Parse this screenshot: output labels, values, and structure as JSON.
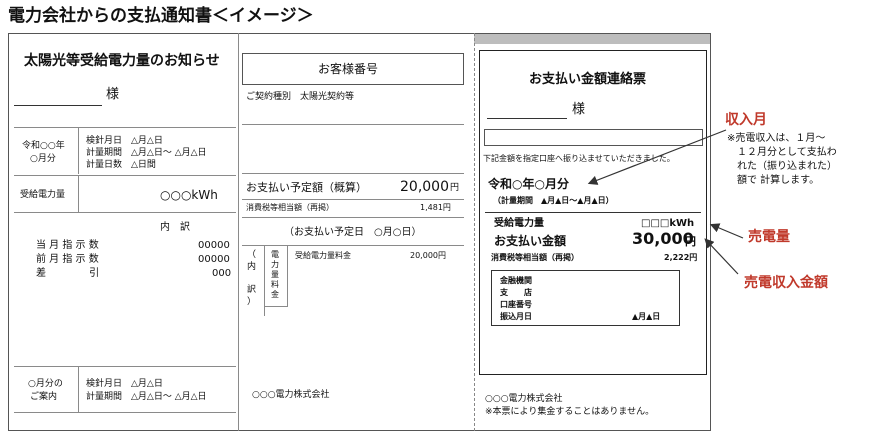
{
  "page_title": "電力会社からの支払通知書＜イメージ＞",
  "left": {
    "heading": "太陽光等受給電力量のお知らせ",
    "sama": "様",
    "period_label_1": "令和○○年",
    "period_label_2": "○月分",
    "meter_lines": [
      "検針月日　△月△日",
      "計量期間　△月△日～ △月△日",
      "計量日数　△日間"
    ],
    "received_label": "受給電力量",
    "received_value": "○○○kWh",
    "breakdown_title": "内　訳",
    "rows": [
      {
        "label": "当 月 指 示 数",
        "value": "00000"
      },
      {
        "label": "前 月 指 示 数",
        "value": "00000"
      },
      {
        "label": "差　　　　 引",
        "value": "000"
      }
    ],
    "next_label_1": "○月分の",
    "next_label_2": "ご案内",
    "next_lines": [
      "検針月日　△月△日",
      "計量期間　△月△日～ △月△日"
    ]
  },
  "middle": {
    "customer_no_label": "お客様番号",
    "contract_type": "ご契約種別　太陽光契約等",
    "payment_label": "お支払い予定額（概算）",
    "payment_value": "20,000",
    "yen": "円",
    "tax_label": "消費税等相当額（再掲）",
    "tax_value": "1,481円",
    "pay_date": "（お支払い予定日　○月○日）",
    "uchiwake_v": "（\n内\n\n訳\n）",
    "fee_header_v": "電\n力\n量\n料\n金",
    "fee_label": "受給電力量料金",
    "fee_value": "20,000円",
    "company": "○○○電力株式会社"
  },
  "right": {
    "heading": "お支払い金額連絡票",
    "sama": "様",
    "transfer_note": "下記金額を指定口座へ振り込ませていただきました。",
    "month": "令和○年○月分",
    "period": "（計量期間　▲月▲日～▲月▲日）",
    "received_label": "受給電力量",
    "received_value": "□□□kWh",
    "amount_label": "お支払い金額",
    "amount_value": "30,000",
    "yen": "円",
    "tax_label": "消費税等相当額（再掲）",
    "tax_value": "2,222円",
    "bank_labels": [
      "金融機関",
      "支　　店",
      "口座番号",
      "振込月日"
    ],
    "transfer_date": "▲月▲日",
    "company": "○○○電力株式会社",
    "footnote": "※本票により集金することはありません。"
  },
  "annotations": {
    "income_month": "収入月",
    "income_note": [
      "※売電収入は、１月～",
      "　１２月分として支払わ",
      "　れた（振り込まれた）",
      "　額で 計算します。"
    ],
    "sold_kwh": "売電量",
    "sold_income": "売電収入金額",
    "color": "#c0392b"
  }
}
